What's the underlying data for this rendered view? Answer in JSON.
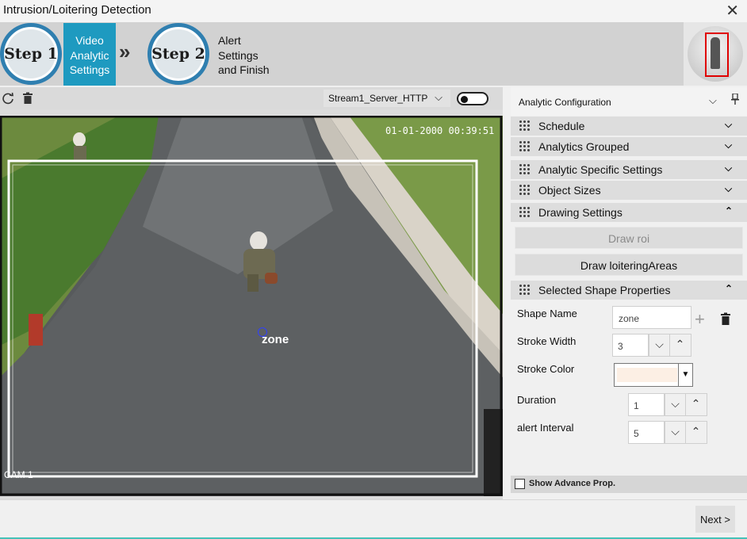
{
  "window": {
    "title": "Intrusion/Loitering Detection",
    "close_glyph": "✕"
  },
  "wizard": {
    "step1": {
      "badge": "Step 1",
      "label_lines": [
        "Video",
        "Analytic",
        "Settings"
      ]
    },
    "step2": {
      "badge": "Step 2",
      "label_lines": [
        "Alert",
        "Settings",
        "and Finish"
      ]
    },
    "separator": "»"
  },
  "video_toolbar": {
    "refresh_icon": "refresh-icon",
    "delete_icon": "trash-icon",
    "stream": "Stream1_Server_HTTP",
    "toggle_on": false
  },
  "video": {
    "timestamp": "01-01-2000 00:39:51",
    "camera_label": "CAM 1",
    "zone_label": "zone"
  },
  "config": {
    "title": "Analytic Configuration",
    "sections": {
      "schedule": "Schedule",
      "analytics_grouped": "Analytics Grouped",
      "analytic_specific": "Analytic Specific Settings",
      "object_sizes": "Object Sizes",
      "drawing_settings": "Drawing Settings",
      "selected_shape": "Selected Shape Properties"
    },
    "draw_roi": "Draw roi",
    "draw_loitering": "Draw loiteringAreas",
    "shape": {
      "name_label": "Shape Name",
      "name_value": "zone",
      "stroke_width_label": "Stroke Width",
      "stroke_width": "3",
      "stroke_color_label": "Stroke Color",
      "stroke_color": "#fcefe4",
      "duration_label": "Duration",
      "duration": "1",
      "alert_interval_label": "alert Interval",
      "alert_interval": "5"
    },
    "show_advance": "Show Advance Prop."
  },
  "footer": {
    "next": "Next >"
  },
  "colors": {
    "accent": "#1e9ac0",
    "step_ring": "#2f7fb0",
    "roi_line": "#ffffff",
    "bottom_bar": "#45c2b8"
  }
}
